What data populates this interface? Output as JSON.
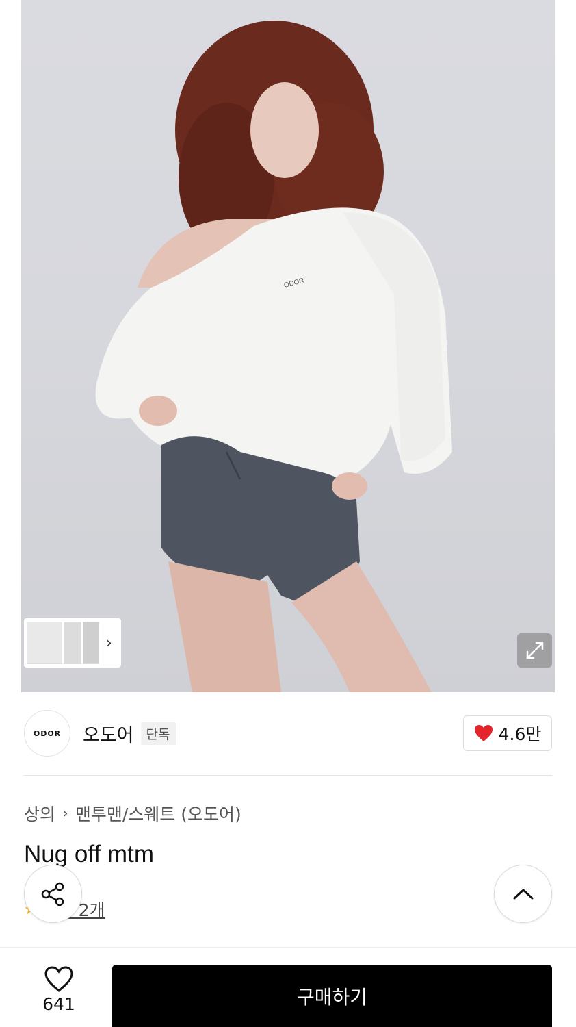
{
  "gallery": {
    "image_alt": "product photo",
    "thumbnail_count": 3
  },
  "brand": {
    "logo_text": "ODOR",
    "name": "오도어",
    "badge": "단독",
    "like_count": "4.6만",
    "like_color": "#e3262d"
  },
  "breadcrumb": {
    "category": "상의",
    "subcategory": "맨투맨/스웨트 (오도어)"
  },
  "product": {
    "title": "Nug off mtm"
  },
  "review": {
    "label": "후기 2개"
  },
  "footer": {
    "wish_count": "641",
    "buy_label": "구매하기"
  },
  "icons": {
    "share": "share-icon",
    "scroll_top": "chevron-up-icon",
    "expand": "expand-icon",
    "heart": "heart-icon"
  }
}
